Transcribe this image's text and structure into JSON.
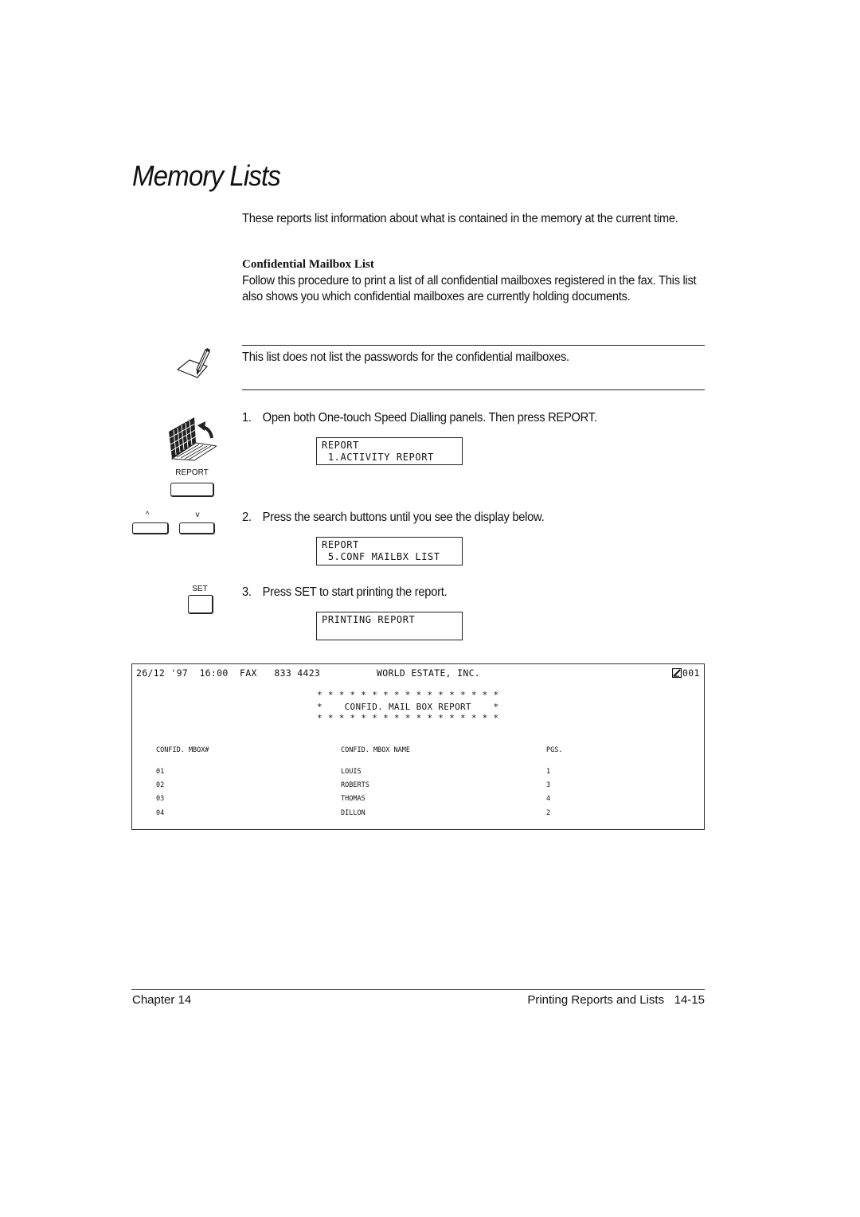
{
  "page": {
    "title": "Memory Lists",
    "intro": "These reports list information about what is contained in the memory at the current time.",
    "section_heading": "Confidential Mailbox List",
    "section_body": "Follow this procedure to print a list of all confidential mailboxes registered in the fax. This list also shows you which confidential mailboxes are currently holding documents.",
    "note": {
      "icon": "note-pencil-icon",
      "text": "This list does not list the passwords for the confidential mailboxes."
    },
    "steps": [
      {
        "num": "1.",
        "text": "Open both One-touch Speed Dialling panels. Then press REPORT.",
        "display": [
          "REPORT",
          " 1.ACTIVITY REPORT"
        ]
      },
      {
        "num": "2.",
        "text": "Press the search buttons until you see the display below.",
        "display": [
          "REPORT",
          " 5.CONF MAILBX LIST"
        ]
      },
      {
        "num": "3.",
        "text": "Press SET to start printing the report.",
        "display": [
          "PRINTING REPORT",
          ""
        ]
      }
    ],
    "keys": {
      "report": "REPORT",
      "up": "^",
      "down": "v",
      "set": "SET"
    },
    "report": {
      "header_left": "26/12 '97  16:00  FAX   833 4423",
      "header_center": "WORLD ESTATE, INC.",
      "header_page": "001",
      "stars_line": "* * * * * * * * * * * * * * * * *",
      "title_line": "*    CONFID. MAIL BOX REPORT    *",
      "columns": [
        "CONFID. MBOX#",
        "CONFID. MBOX NAME",
        "PGS."
      ],
      "rows": [
        {
          "mbox": "01",
          "name": "LOUIS",
          "pgs": "1"
        },
        {
          "mbox": "02",
          "name": "ROBERTS",
          "pgs": "3"
        },
        {
          "mbox": "03",
          "name": "THOMAS",
          "pgs": "4"
        },
        {
          "mbox": "04",
          "name": "DILLON",
          "pgs": "2"
        }
      ]
    },
    "footer": {
      "left": "Chapter 14",
      "right_title": "Printing Reports and Lists",
      "page_number": "14-15"
    }
  }
}
